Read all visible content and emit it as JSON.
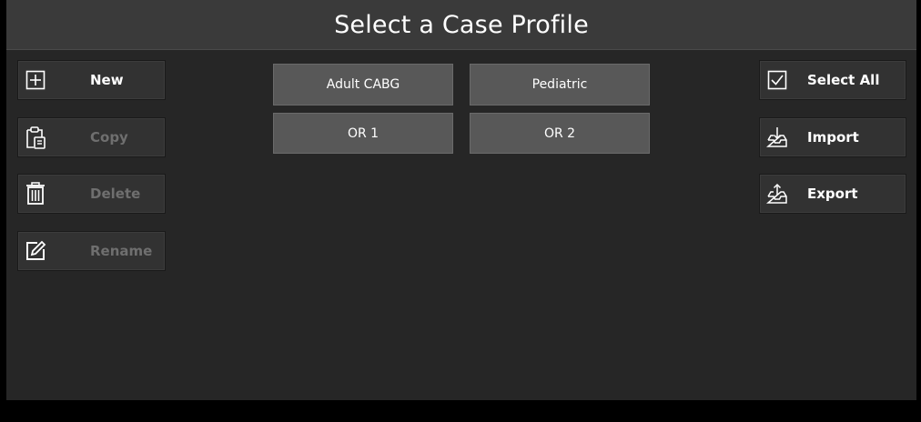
{
  "title": "Select a Case Profile",
  "left_actions": [
    {
      "label": "New",
      "icon": "plus-box-icon",
      "enabled": true
    },
    {
      "label": "Copy",
      "icon": "clipboard-copy-icon",
      "enabled": false
    },
    {
      "label": "Delete",
      "icon": "trash-icon",
      "enabled": false
    },
    {
      "label": "Rename",
      "icon": "edit-pencil-icon",
      "enabled": false
    }
  ],
  "profiles": [
    "Adult CABG",
    "Pediatric",
    "OR 1",
    "OR 2"
  ],
  "right_actions": [
    {
      "label": "Select All",
      "icon": "checkbox-icon"
    },
    {
      "label": "Import",
      "icon": "import-tray-icon"
    },
    {
      "label": "Export",
      "icon": "export-tray-icon"
    }
  ],
  "colors": {
    "background": "#262626",
    "titlebar": "#3a3a3a",
    "profile_button": "#585858",
    "disabled_text": "#6f6f6f"
  }
}
